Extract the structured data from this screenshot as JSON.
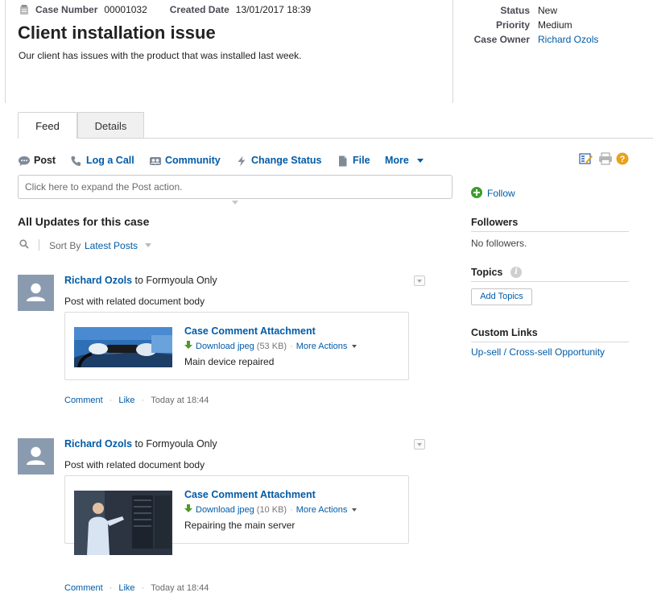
{
  "header": {
    "case_number_label": "Case Number",
    "case_number": "00001032",
    "created_date_label": "Created Date",
    "created_date": "13/01/2017 18:39",
    "title": "Client installation issue",
    "description": "Our client has issues with the product that was installed last week.",
    "details": [
      {
        "label": "Status",
        "value": "New"
      },
      {
        "label": "Priority",
        "value": "Medium"
      },
      {
        "label": "Case Owner",
        "value": "Richard Ozols"
      }
    ]
  },
  "tabs": [
    {
      "label": "Feed",
      "active": true
    },
    {
      "label": "Details",
      "active": false
    }
  ],
  "publisher": {
    "actions": [
      {
        "label": "Post",
        "icon": "speech-bubble-icon"
      },
      {
        "label": "Log a Call",
        "icon": "phone-icon"
      },
      {
        "label": "Community",
        "icon": "community-icon"
      },
      {
        "label": "Change Status",
        "icon": "lightning-icon"
      },
      {
        "label": "File",
        "icon": "document-icon"
      },
      {
        "label": "More",
        "icon": "chevron-down-icon"
      }
    ],
    "placeholder": "Click here to expand the Post action."
  },
  "feed": {
    "title": "All Updates for this case",
    "sort_label": "Sort By",
    "sort_value": "Latest Posts",
    "posts": [
      {
        "author": "Richard Ozols",
        "audience": "to Formyoula Only",
        "body": "Post with related document body",
        "attachment": {
          "title": "Case Comment Attachment",
          "download": "Download jpeg",
          "size": "(53 KB)",
          "more": "More Actions",
          "caption": "Main device repaired"
        },
        "actions": {
          "comment": "Comment",
          "like": "Like",
          "time": "Today at 18:44"
        }
      },
      {
        "author": "Richard Ozols",
        "audience": "to Formyoula Only",
        "body": "Post with related document body",
        "attachment": {
          "title": "Case Comment Attachment",
          "download": "Download jpeg",
          "size": "(10 KB)",
          "more": "More Actions",
          "caption": "Repairing the main server"
        },
        "actions": {
          "comment": "Comment",
          "like": "Like",
          "time": "Today at 18:44"
        }
      }
    ]
  },
  "sidebar": {
    "follow": "Follow",
    "followers_title": "Followers",
    "followers_empty": "No followers.",
    "topics_title": "Topics",
    "add_topics": "Add Topics",
    "custom_links_title": "Custom Links",
    "custom_link": "Up-sell / Cross-sell Opportunity"
  },
  "colors": {
    "link": "#015ba7",
    "follow_green": "#3c9d2e",
    "help_orange": "#e8a21c",
    "avatar": "#8a9bb0"
  }
}
